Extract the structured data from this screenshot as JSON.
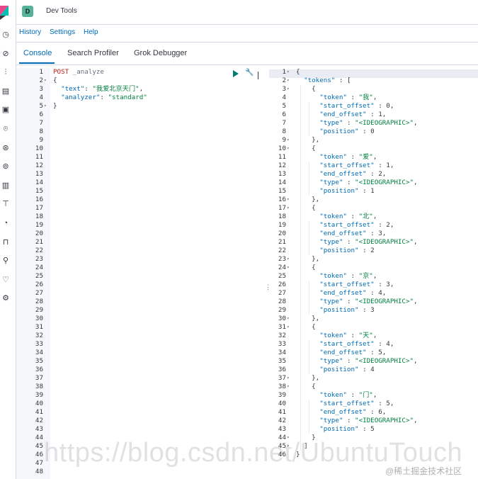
{
  "header": {
    "avatar_letter": "D",
    "title": "Dev Tools"
  },
  "menu": [
    "History",
    "Settings",
    "Help"
  ],
  "tabs": [
    "Console",
    "Search Profiler",
    "Grok Debugger"
  ],
  "rail_icons": [
    "clock-icon",
    "compass-icon",
    "chart-icon",
    "dashboard-icon",
    "canvas-icon",
    "maps-icon",
    "ml-icon",
    "infra-icon",
    "logs-icon",
    "apm-icon",
    "uptime-icon",
    "siem-icon",
    "devtools-icon",
    "monitoring-icon",
    "management-icon"
  ],
  "request": {
    "lines": [
      "POST _analyze",
      "{",
      "  \"text\": \"我爱北京天门\",",
      "  \"analyzer\": \"standard\"",
      "}"
    ],
    "line_count": 48
  },
  "response": {
    "lines": [
      "{",
      "  \"tokens\" : [",
      "    {",
      "      \"token\" : \"我\",",
      "      \"start_offset\" : 0,",
      "      \"end_offset\" : 1,",
      "      \"type\" : \"<IDEOGRAPHIC>\",",
      "      \"position\" : 0",
      "    },",
      "    {",
      "      \"token\" : \"爱\",",
      "      \"start_offset\" : 1,",
      "      \"end_offset\" : 2,",
      "      \"type\" : \"<IDEOGRAPHIC>\",",
      "      \"position\" : 1",
      "    },",
      "    {",
      "      \"token\" : \"北\",",
      "      \"start_offset\" : 2,",
      "      \"end_offset\" : 3,",
      "      \"type\" : \"<IDEOGRAPHIC>\",",
      "      \"position\" : 2",
      "    },",
      "    {",
      "      \"token\" : \"京\",",
      "      \"start_offset\" : 3,",
      "      \"end_offset\" : 4,",
      "      \"type\" : \"<IDEOGRAPHIC>\",",
      "      \"position\" : 3",
      "    },",
      "    {",
      "      \"token\" : \"天\",",
      "      \"start_offset\" : 4,",
      "      \"end_offset\" : 5,",
      "      \"type\" : \"<IDEOGRAPHIC>\",",
      "      \"position\" : 4",
      "    },",
      "    {",
      "      \"token\" : \"门\",",
      "      \"start_offset\" : 5,",
      "      \"end_offset\" : 6,",
      "      \"type\" : \"<IDEOGRAPHIC>\",",
      "      \"position\" : 5",
      "    }",
      "  ]",
      "}"
    ],
    "fold_lines": [
      1,
      2,
      3,
      9,
      10,
      16,
      17,
      23,
      24,
      30,
      31,
      37,
      38,
      44,
      45
    ]
  },
  "watermark": "https://blog.csdn.net/UbuntuTouch",
  "credit": "@稀土掘金技术社区",
  "colors": {
    "accent": "#006bb4",
    "keyword": "#c41a16",
    "string": "#017f3f",
    "run": "#017d73"
  }
}
